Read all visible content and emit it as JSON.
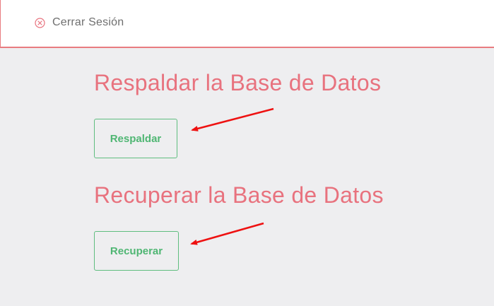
{
  "header": {
    "logout_label": "Cerrar Sesión",
    "logout_icon": "close-circle-icon"
  },
  "backup": {
    "title": "Respaldar la Base de Datos",
    "button_label": "Respaldar"
  },
  "restore": {
    "title": "Recuperar la Base de Datos",
    "button_label": "Recuperar"
  },
  "colors": {
    "accent": "#e8727e",
    "button": "#4fb673",
    "arrow": "#ee1111",
    "background": "#eeeef0"
  }
}
